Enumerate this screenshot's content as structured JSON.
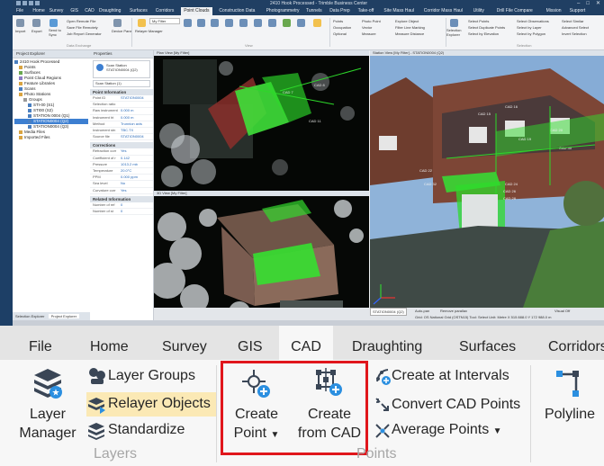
{
  "screenshot": {
    "app_title": "2410 Hook Processed - Trimble Business Center",
    "menu": [
      "File",
      "Home",
      "Survey",
      "GIS",
      "CAD",
      "Draughting",
      "Surfaces",
      "Corridors",
      "Point Clouds",
      "Construction Data",
      "Photogrammetry",
      "Tunnels",
      "Data Prep",
      "Take-off",
      "Site Mass Haul",
      "Corridor Mass Haul",
      "Utility",
      "Drill File Compare",
      "Mission",
      "Support"
    ],
    "active_menu": "Point Clouds",
    "filter_label": "My Filter",
    "mini_groups": [
      "Data Exchange",
      "View",
      "Selection"
    ],
    "mini_tools": [
      "Import",
      "Export",
      "Send to Sync",
      "Open Remote File",
      "Save File Remotely",
      "Job Report Generator",
      "Device Pane",
      "Relayer Manager",
      "My Filter",
      "View Filter",
      "Plan View",
      "3D View",
      "Points Manager",
      "Cutting Plane View",
      "Limit Box",
      "Station Manager",
      "Google Earth",
      "History Log View",
      "Project Explorer"
    ],
    "mini_right_tools": [
      "Points",
      "Occupation",
      "Optional",
      "Photo Point",
      "Vector",
      "Measure",
      "Explore Object",
      "Filter Line Marking",
      "Measure Distance",
      "Selection Explorer",
      "Select Points",
      "Select Duplicate Points",
      "Select by Elevation",
      "Select Observations",
      "Select by Layer",
      "Select by Polygon",
      "Select Similar",
      "Advanced Select",
      "Invert Selection"
    ],
    "project_explorer": {
      "title": "Project Explorer",
      "items": [
        {
          "label": "2410 Hook Processed",
          "indent": 0,
          "color": "#4a7fc0",
          "selected": false
        },
        {
          "label": "Points",
          "indent": 1,
          "color": "#d9a441",
          "selected": false
        },
        {
          "label": "Surfaces",
          "indent": 1,
          "color": "#6aa84f",
          "selected": false
        },
        {
          "label": "Point Cloud Regions",
          "indent": 1,
          "color": "#8e7cc3",
          "selected": false
        },
        {
          "label": "Feature Libraries",
          "indent": 1,
          "color": "#d9a441",
          "selected": false
        },
        {
          "label": "Scans",
          "indent": 1,
          "color": "#4a7fc0",
          "selected": false
        },
        {
          "label": "Photo Stations",
          "indent": 1,
          "color": "#d9a441",
          "selected": false
        },
        {
          "label": "Groups",
          "indent": 2,
          "color": "#999999",
          "selected": false
        },
        {
          "label": "STI-00 (S1)",
          "indent": 3,
          "color": "#4a7fc0",
          "selected": false
        },
        {
          "label": "STI00 (S2)",
          "indent": 3,
          "color": "#4a7fc0",
          "selected": false
        },
        {
          "label": "STATION 0004 (Q1)",
          "indent": 3,
          "color": "#4a7fc0",
          "selected": false
        },
        {
          "label": "STATION0004 (Q2)",
          "indent": 3,
          "color": "#4a7fc0",
          "selected": true
        },
        {
          "label": "STATION0004 (Q3)",
          "indent": 3,
          "color": "#4a7fc0",
          "selected": false
        },
        {
          "label": "Media Files",
          "indent": 1,
          "color": "#d9a441",
          "selected": false
        },
        {
          "label": "Imported Files",
          "indent": 1,
          "color": "#d9a441",
          "selected": false
        }
      ],
      "bottom_tabs": [
        "Selection Explorer",
        "Project Explorer"
      ]
    },
    "properties": {
      "title": "Properties",
      "station_type": "Scan Station",
      "station_name": "STATION0004 (Q2)",
      "selected": "Scan Station (1)",
      "sections": [
        {
          "name": "Point Information",
          "rows": [
            [
              "Point ID",
              "STATION0004"
            ],
            [
              "Selection ratio",
              ""
            ],
            [
              "Raw instrument",
              "0.000 m"
            ],
            [
              "Instrument ht",
              "0.000 m"
            ],
            [
              "Method",
              "Trunnion axis"
            ],
            [
              "Instrument stn",
              "TBC.TX"
            ],
            [
              "Source file",
              "STATION0004"
            ]
          ]
        },
        {
          "name": "Corrections",
          "rows": [
            [
              "Refraction corr",
              "Yes"
            ],
            [
              "Coefficient of r",
              "0.142"
            ],
            [
              "Pressure",
              "1013.2 mb"
            ],
            [
              "Temperature",
              "20.0°C"
            ],
            [
              "PPM",
              "0.000 ppm"
            ],
            [
              "Sea level",
              "No"
            ],
            [
              "Curvature corr",
              "Yes"
            ]
          ]
        },
        {
          "name": "Related Information",
          "rows": [
            [
              "Number of ref",
              "0"
            ],
            [
              "Number of st",
              "0"
            ]
          ]
        }
      ]
    },
    "views": {
      "plan_title": "Plan View [My Filter]",
      "view3d_title": "3D View [My Filter]",
      "station_title": "Station View [My Filter] - STATION0004 (Q2)",
      "cad_labels": [
        "CAD 7",
        "CAD 8",
        "CAD 11",
        "CAD 15",
        "CAD 16",
        "CAD 19",
        "CAD 20",
        "CAD 22",
        "CAD 24",
        "CAD 26",
        "CAD 28",
        "CAD 30",
        "CAD 32"
      ]
    },
    "status": {
      "station": "STATION0004 (Q2)",
      "options": [
        "Auto-pan",
        "Remove parallax",
        "Visual Off"
      ],
      "coords": "Grid: OS National Grid (OSTN15)  Tool: Select  Unit: Metre  X 515 888.0  Y 172 988.0 m"
    }
  },
  "ribbon": {
    "tabs": [
      "File",
      "Home",
      "Survey",
      "GIS",
      "CAD",
      "Draughting",
      "Surfaces",
      "Corridors"
    ],
    "active_tab": "CAD",
    "layers": {
      "layer_manager_line1": "Layer",
      "layer_manager_line2": "Manager",
      "layer_groups": "Layer Groups",
      "relayer_objects": "Relayer Objects",
      "standardize": "Standardize",
      "group_name": "Layers"
    },
    "points": {
      "create_point_line1": "Create",
      "create_point_line2": "Point",
      "create_from_cad_line1": "Create",
      "create_from_cad_line2": "from CAD",
      "create_at_intervals": "Create at Intervals",
      "convert_cad_points": "Convert CAD Points",
      "average_points": "Average Points",
      "group_name": "Points"
    },
    "polyline": "Polyline",
    "colors": {
      "accent": "#2b8fe0",
      "highlight": "#fbe9b5",
      "callout": "#e0161c",
      "icon_dark": "#3a4656"
    }
  }
}
